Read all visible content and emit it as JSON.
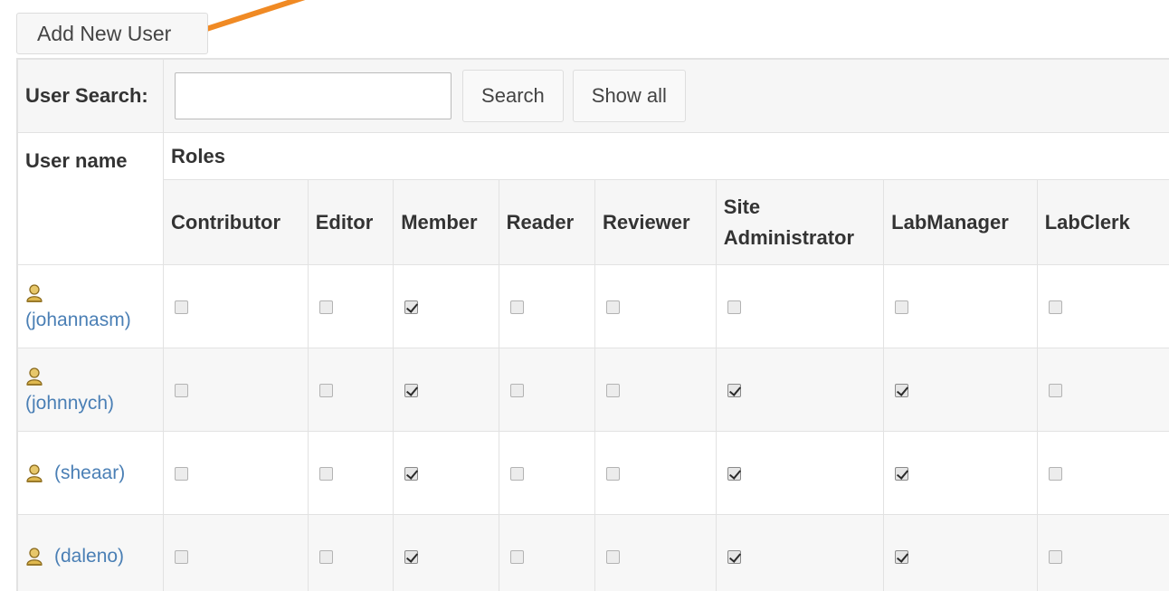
{
  "toolbar": {
    "add_user_label": "Add New User"
  },
  "search": {
    "label": "User Search:",
    "value": "",
    "placeholder": "",
    "search_button": "Search",
    "show_all_button": "Show all"
  },
  "table": {
    "username_header": "User name",
    "roles_header": "Roles",
    "role_columns": [
      "Contributor",
      "Editor",
      "Member",
      "Reader",
      "Reviewer",
      "Site Administrator",
      "LabManager",
      "LabClerk"
    ],
    "users": [
      {
        "name": "(johannasm)",
        "icon": "user-icon",
        "roles": [
          false,
          false,
          true,
          false,
          false,
          false,
          false,
          false
        ]
      },
      {
        "name": "(johnnych)",
        "icon": "user-icon",
        "roles": [
          false,
          false,
          true,
          false,
          false,
          true,
          true,
          false
        ]
      },
      {
        "name": "(sheaar)",
        "icon": "user-icon",
        "roles": [
          false,
          false,
          true,
          false,
          false,
          true,
          true,
          false
        ]
      },
      {
        "name": "(daleno)",
        "icon": "user-icon",
        "roles": [
          false,
          false,
          true,
          false,
          false,
          true,
          true,
          false
        ]
      }
    ]
  },
  "colors": {
    "annotation_arrow": "#f08a24",
    "link": "#4a7fb5"
  }
}
